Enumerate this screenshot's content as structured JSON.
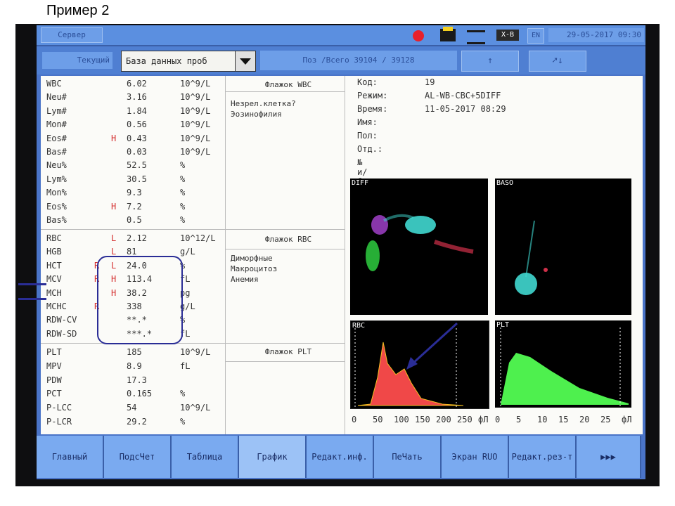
{
  "caption": "Пример 2",
  "topbar": {
    "left_button": "Сервер",
    "xb_label": "X-B",
    "lang": "EN",
    "datetime": "29-05-2017 09:30",
    "icons": [
      "record-icon",
      "printer-icon",
      "network-icon",
      "xb-icon"
    ]
  },
  "toolbar": {
    "label": "Текущий",
    "select_value": "База данных проб",
    "position": "Поз /Всего 39104 / 39128",
    "up_arrow": "↑",
    "cursor_down": "↓"
  },
  "params": [
    {
      "name": "WBC",
      "f1": "",
      "f2": "",
      "value": "6.02",
      "unit": "10^9/L"
    },
    {
      "name": "Neu#",
      "f1": "",
      "f2": "",
      "value": "3.16",
      "unit": "10^9/L"
    },
    {
      "name": "Lym#",
      "f1": "",
      "f2": "",
      "value": "1.84",
      "unit": "10^9/L"
    },
    {
      "name": "Mon#",
      "f1": "",
      "f2": "",
      "value": "0.56",
      "unit": "10^9/L"
    },
    {
      "name": "Eos#",
      "f1": "",
      "f2": "H",
      "value": "0.43",
      "unit": "10^9/L"
    },
    {
      "name": "Bas#",
      "f1": "",
      "f2": "",
      "value": "0.03",
      "unit": "10^9/L"
    },
    {
      "name": "Neu%",
      "f1": "",
      "f2": "",
      "value": "52.5",
      "unit": "%"
    },
    {
      "name": "Lym%",
      "f1": "",
      "f2": "",
      "value": "30.5",
      "unit": "%"
    },
    {
      "name": "Mon%",
      "f1": "",
      "f2": "",
      "value": "9.3",
      "unit": "%"
    },
    {
      "name": "Eos%",
      "f1": "",
      "f2": "H",
      "value": "7.2",
      "unit": "%"
    },
    {
      "name": "Bas%",
      "f1": "",
      "f2": "",
      "value": "0.5",
      "unit": "%"
    },
    {
      "name": "RBC",
      "f1": "",
      "f2": "L",
      "value": "2.12",
      "unit": "10^12/L"
    },
    {
      "name": "HGB",
      "f1": "",
      "f2": "L",
      "value": "81",
      "unit": "g/L"
    },
    {
      "name": "HCT",
      "f1": "R",
      "f2": "L",
      "value": "24.0",
      "unit": "%"
    },
    {
      "name": "MCV",
      "f1": "R",
      "f2": "H",
      "value": "113.4",
      "unit": "fL"
    },
    {
      "name": "MCH",
      "f1": "",
      "f2": "H",
      "value": "38.2",
      "unit": "pg"
    },
    {
      "name": "MCHC",
      "f1": "R",
      "f2": "",
      "value": "338",
      "unit": "g/L"
    },
    {
      "name": "RDW-CV",
      "f1": "",
      "f2": "",
      "value": "**.*",
      "unit": "%"
    },
    {
      "name": "RDW-SD",
      "f1": "",
      "f2": "",
      "value": "***.*",
      "unit": "fL"
    },
    {
      "name": "PLT",
      "f1": "",
      "f2": "",
      "value": "185",
      "unit": "10^9/L"
    },
    {
      "name": "MPV",
      "f1": "",
      "f2": "",
      "value": "8.9",
      "unit": "fL"
    },
    {
      "name": "PDW",
      "f1": "",
      "f2": "",
      "value": "17.3",
      "unit": ""
    },
    {
      "name": "PCT",
      "f1": "",
      "f2": "",
      "value": "0.165",
      "unit": "%"
    },
    {
      "name": "P-LCC",
      "f1": "",
      "f2": "",
      "value": "54",
      "unit": "10^9/L"
    },
    {
      "name": "P-LCR",
      "f1": "",
      "f2": "",
      "value": "29.2",
      "unit": "%"
    }
  ],
  "flags": {
    "wbc_header": "Флажок WBC",
    "wbc_lines": [
      "Незрел.клетка?",
      "Эозинофилия"
    ],
    "rbc_header": "Флажок RBC",
    "rbc_lines": [
      "Диморфные",
      "Макроцитоз",
      "Анемия"
    ],
    "plt_header": "Флажок PLT"
  },
  "sample": [
    {
      "key": "Код:",
      "value": "19"
    },
    {
      "key": "Режим:",
      "value": "AL-WB-CBC+5DIFF"
    },
    {
      "key": "Время:",
      "value": "11-05-2017 08:29"
    },
    {
      "key": "Имя:",
      "value": ""
    },
    {
      "key": "Пол:",
      "value": ""
    },
    {
      "key": "Отд.:",
      "value": ""
    },
    {
      "key": "№ и/б:",
      "value": ""
    }
  ],
  "plots": {
    "diff_label": "DIFF",
    "baso_label": "BASO",
    "rbc_label": "RBC",
    "plt_label": "PLT",
    "rbc_axis": [
      "0",
      "50",
      "100",
      "150",
      "200",
      "250",
      "фЛ"
    ],
    "plt_axis": [
      "0",
      "5",
      "10",
      "15",
      "20",
      "25",
      "фЛ"
    ]
  },
  "bottom": [
    "Главный",
    "ПодсЧет",
    "Таблица",
    "График",
    "Редакт.инф.",
    "ПеЧать",
    "Экран RUO",
    "Редакт.рез-т",
    "▶▶▶"
  ]
}
